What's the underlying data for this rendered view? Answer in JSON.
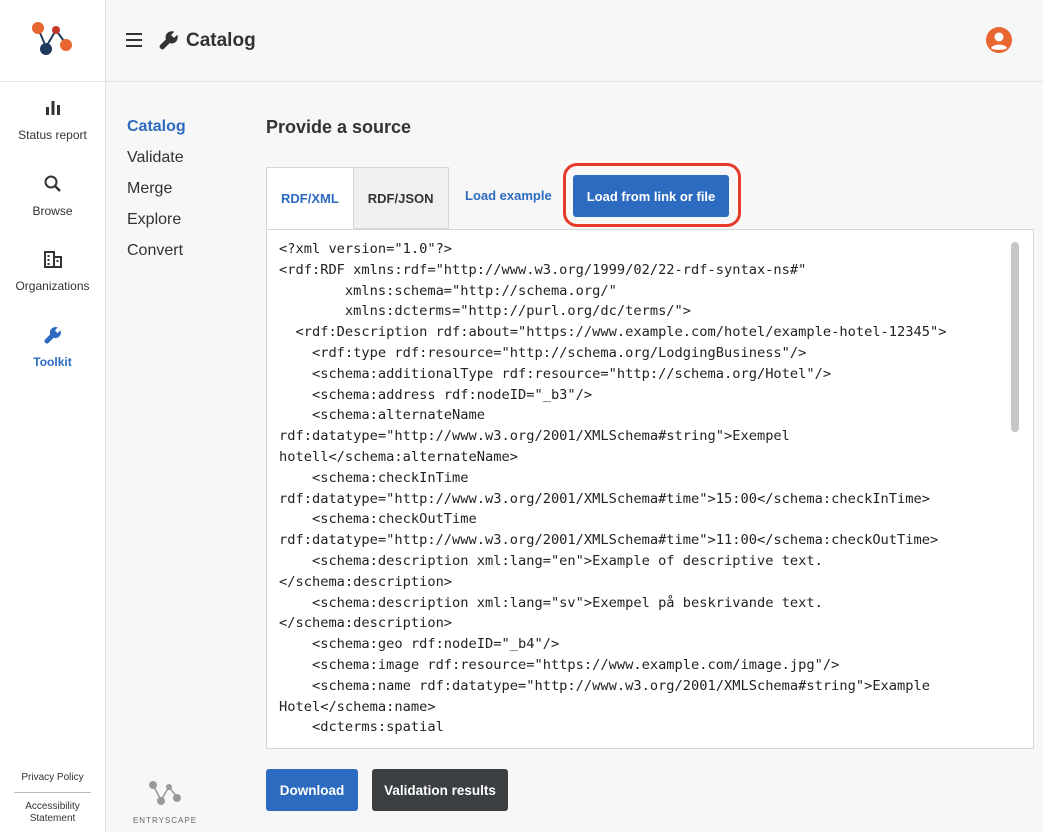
{
  "header": {
    "title": "Catalog"
  },
  "rail": {
    "items": [
      {
        "label": "Status report",
        "icon": "bar-chart-icon"
      },
      {
        "label": "Browse",
        "icon": "search-icon"
      },
      {
        "label": "Organizations",
        "icon": "building-icon"
      },
      {
        "label": "Toolkit",
        "icon": "wrench-icon",
        "active": true
      }
    ],
    "footer": {
      "privacy": "Privacy Policy",
      "accessibility": "Accessibility Statement"
    }
  },
  "subnav": {
    "items": [
      "Catalog",
      "Validate",
      "Merge",
      "Explore",
      "Convert"
    ],
    "active": "Catalog"
  },
  "brand": {
    "label": "ENTRYSCAPE"
  },
  "main": {
    "heading": "Provide a source",
    "tabs": [
      "RDF/XML",
      "RDF/JSON"
    ],
    "active_tab": "RDF/XML",
    "load_example": "Load example",
    "load_from": "Load from link or file",
    "code": "<?xml version=\"1.0\"?>\n<rdf:RDF xmlns:rdf=\"http://www.w3.org/1999/02/22-rdf-syntax-ns#\"\n        xmlns:schema=\"http://schema.org/\"\n        xmlns:dcterms=\"http://purl.org/dc/terms/\">\n  <rdf:Description rdf:about=\"https://www.example.com/hotel/example-hotel-12345\">\n    <rdf:type rdf:resource=\"http://schema.org/LodgingBusiness\"/>\n    <schema:additionalType rdf:resource=\"http://schema.org/Hotel\"/>\n    <schema:address rdf:nodeID=\"_b3\"/>\n    <schema:alternateName\nrdf:datatype=\"http://www.w3.org/2001/XMLSchema#string\">Exempel\nhotell</schema:alternateName>\n    <schema:checkInTime\nrdf:datatype=\"http://www.w3.org/2001/XMLSchema#time\">15:00</schema:checkInTime>\n    <schema:checkOutTime\nrdf:datatype=\"http://www.w3.org/2001/XMLSchema#time\">11:00</schema:checkOutTime>\n    <schema:description xml:lang=\"en\">Example of descriptive text.\n</schema:description>\n    <schema:description xml:lang=\"sv\">Exempel på beskrivande text.\n</schema:description>\n    <schema:geo rdf:nodeID=\"_b4\"/>\n    <schema:image rdf:resource=\"https://www.example.com/image.jpg\"/>\n    <schema:name rdf:datatype=\"http://www.w3.org/2001/XMLSchema#string\">Example\nHotel</schema:name>\n    <dcterms:spatial",
    "download": "Download",
    "validation": "Validation results"
  },
  "colors": {
    "accent": "#2c6bbf",
    "highlight": "#e53a2a",
    "logo_orange": "#e8662f",
    "logo_navy": "#1f3a5f"
  }
}
